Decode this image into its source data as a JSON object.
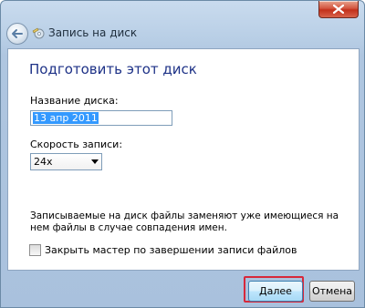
{
  "window": {
    "title": "Запись на диск"
  },
  "page": {
    "heading": "Подготовить этот диск",
    "disc_name_label": "Название диска:",
    "disc_name_value": "13 апр 2011",
    "speed_label": "Скорость записи:",
    "speed_value": "24x",
    "note": "Записываемые на диск файлы заменяют уже имеющиеся на нем файлы в случае совпадения имен.",
    "close_checkbox_label": "Закрыть мастер по завершении записи файлов",
    "close_checkbox_checked": false
  },
  "footer": {
    "next_label": "Далее",
    "cancel_label": "Отмена"
  },
  "colors": {
    "heading": "#1e3287",
    "close_button": "#c2301b",
    "highlight": "#d7283b"
  }
}
